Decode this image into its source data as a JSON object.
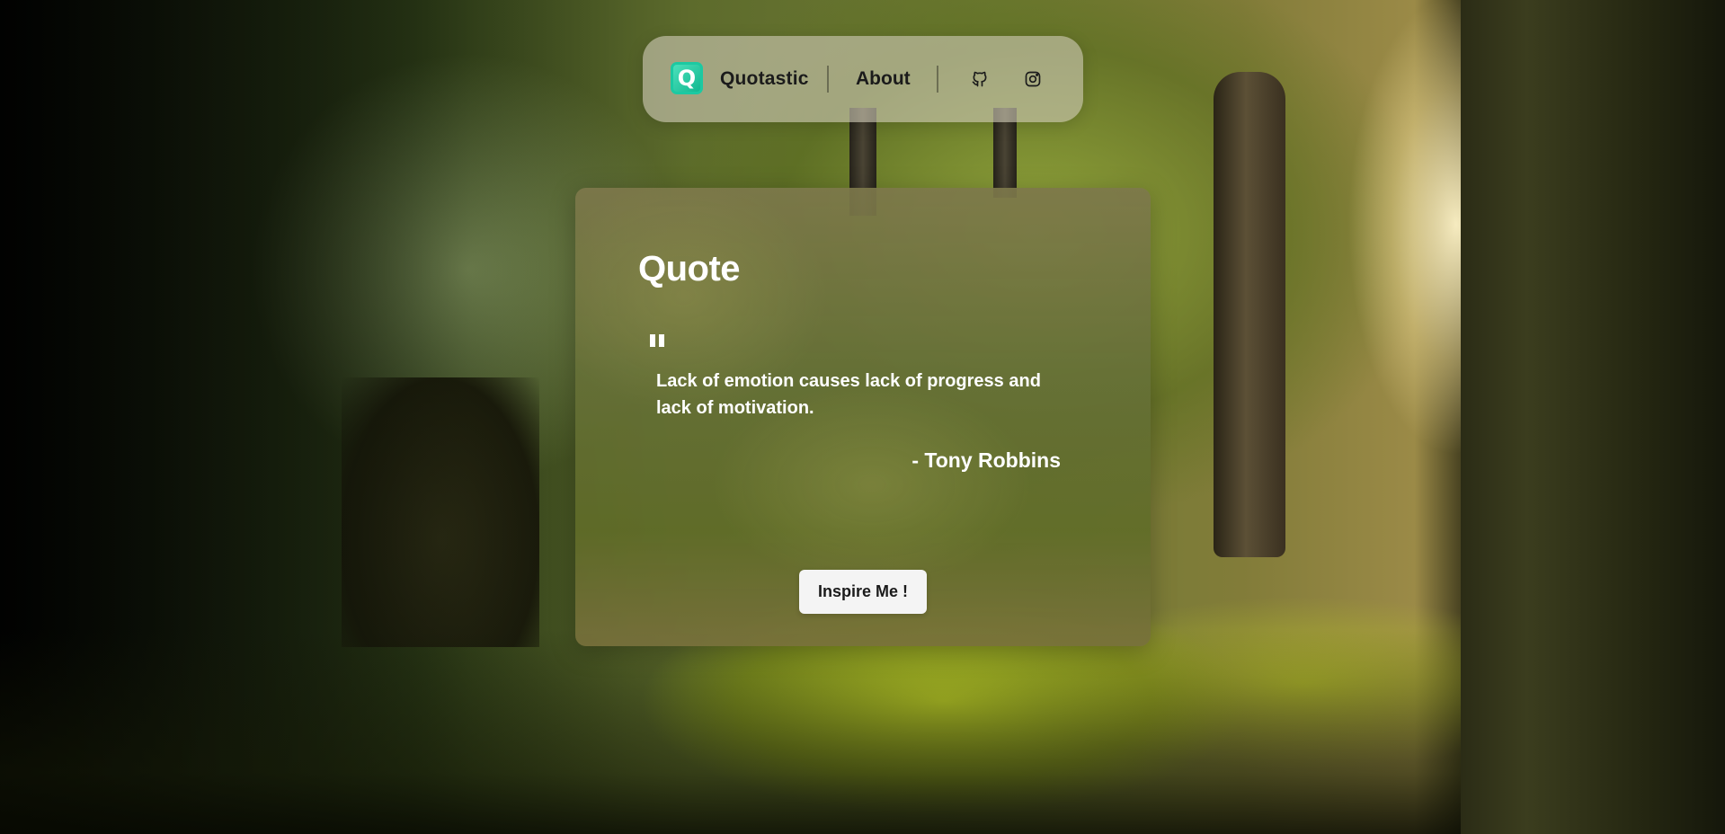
{
  "navbar": {
    "logo_letter": "Q",
    "brand": "Quotastic",
    "about": "About",
    "icons": [
      "github-icon",
      "instagram-icon"
    ]
  },
  "card": {
    "title": "Quote",
    "quote": "Lack of emotion causes lack of progress and lack of motivation.",
    "author": "- Tony Robbins",
    "button": "Inspire Me !"
  },
  "colors": {
    "logo_accent": "#1cc9a2",
    "text_dark": "#1b1b1b",
    "text_light": "#ffffff",
    "button_bg": "#f4f4f4"
  }
}
